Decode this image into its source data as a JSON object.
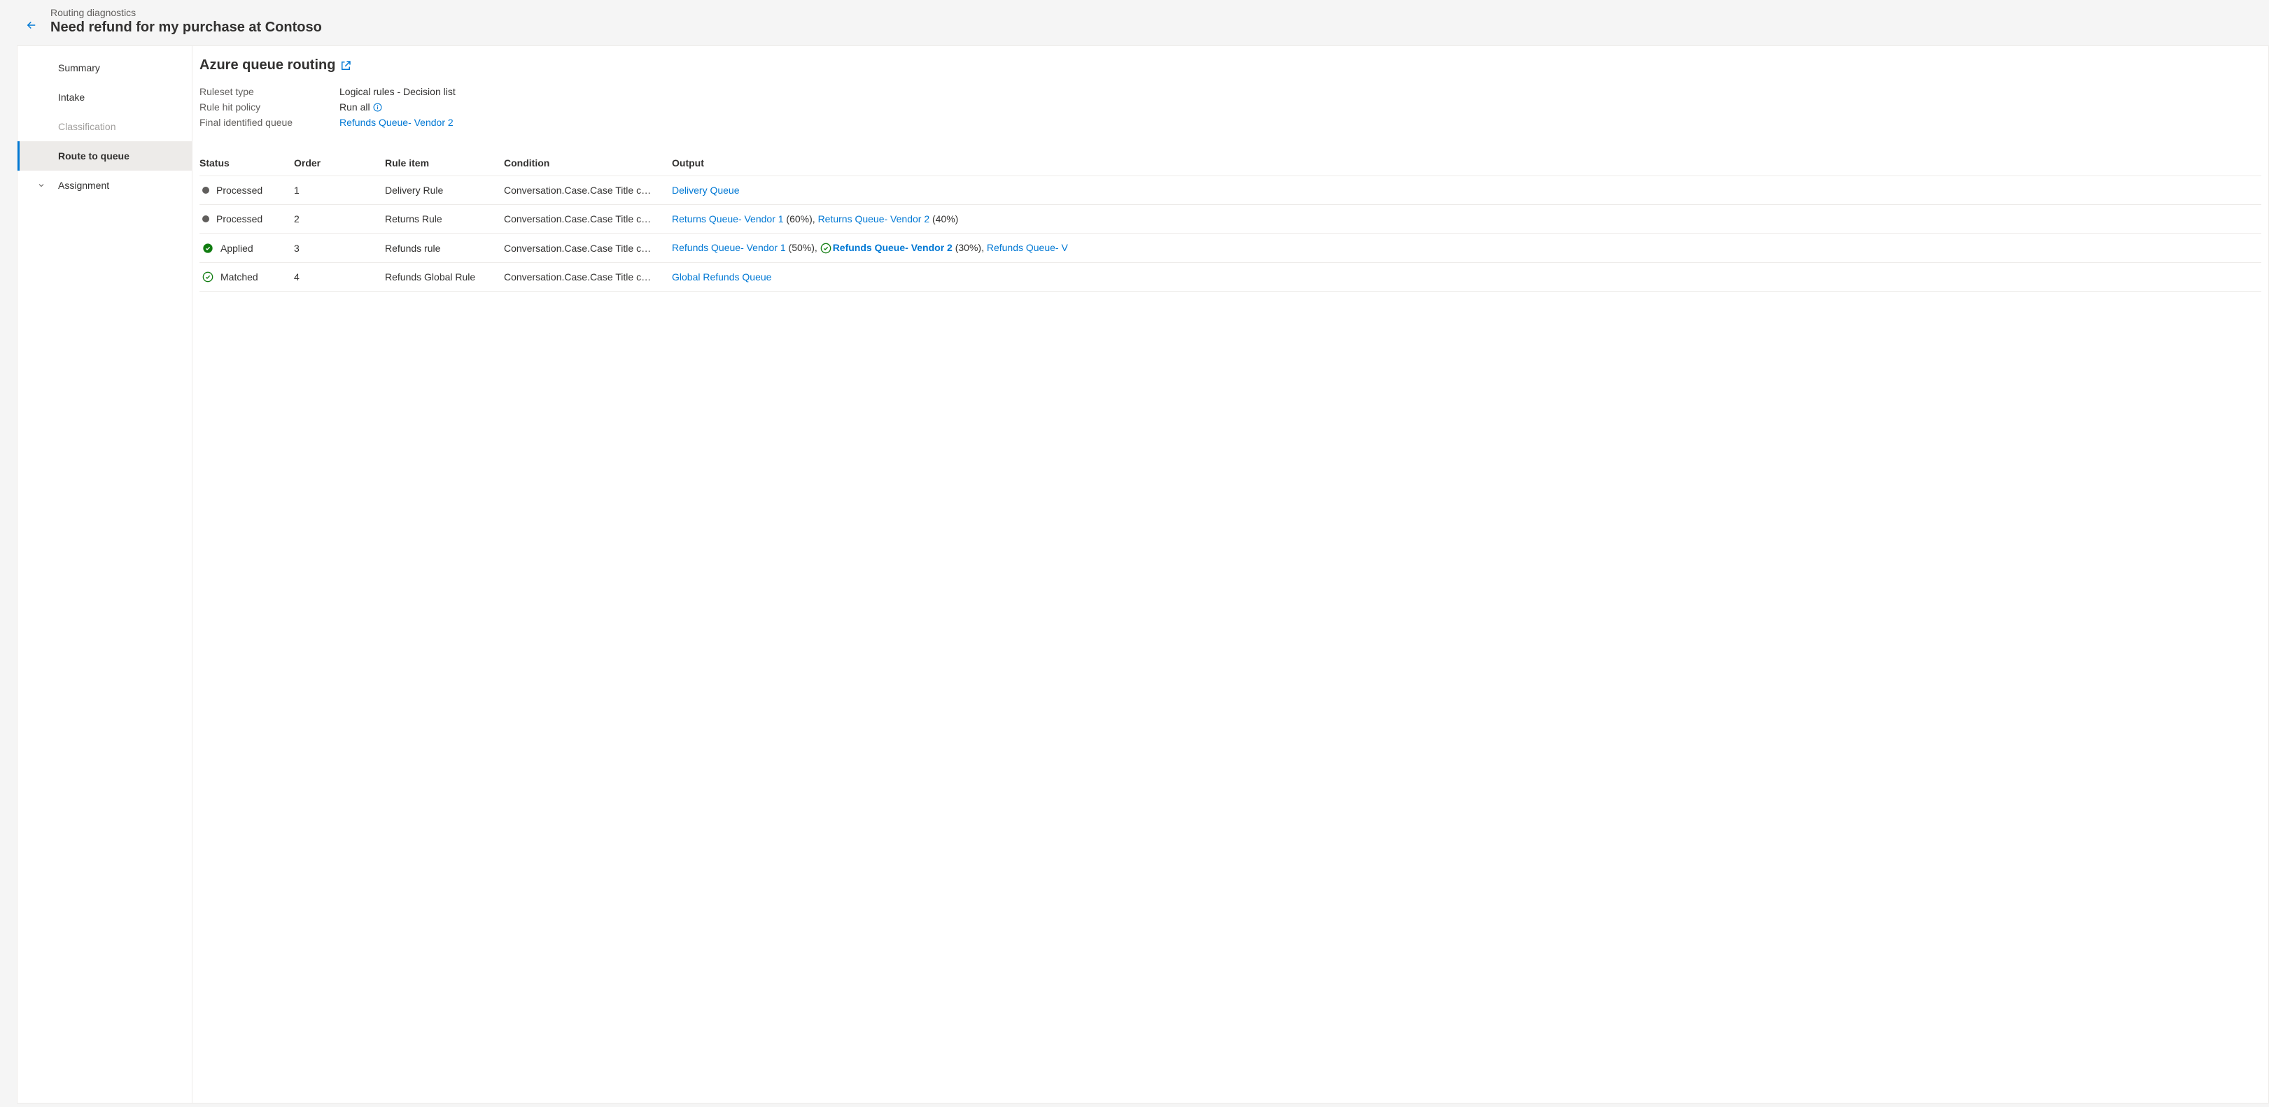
{
  "header": {
    "breadcrumb": "Routing diagnostics",
    "title": "Need refund for my purchase at Contoso"
  },
  "sidebar": {
    "items": [
      {
        "label": "Summary"
      },
      {
        "label": "Intake"
      },
      {
        "label": "Classification"
      },
      {
        "label": "Route to queue"
      },
      {
        "label": "Assignment"
      }
    ]
  },
  "main": {
    "section_title": "Azure queue routing",
    "kv": {
      "ruleset_type_label": "Ruleset type",
      "ruleset_type_value": "Logical rules - Decision list",
      "rule_hit_label": "Rule hit policy",
      "rule_hit_value": "Run all",
      "final_queue_label": "Final identified queue",
      "final_queue_value": "Refunds Queue- Vendor 2"
    },
    "columns": {
      "status": "Status",
      "order": "Order",
      "rule_item": "Rule item",
      "condition": "Condition",
      "output": "Output"
    },
    "rows": [
      {
        "status": "Processed",
        "status_kind": "processed",
        "order": "1",
        "rule_item": "Delivery Rule",
        "condition": "Conversation.Case.Case Title c…",
        "outputs": [
          {
            "text": "Delivery Queue",
            "pct": ""
          }
        ]
      },
      {
        "status": "Processed",
        "status_kind": "processed",
        "order": "2",
        "rule_item": "Returns Rule",
        "condition": "Conversation.Case.Case Title c…",
        "outputs": [
          {
            "text": "Returns Queue- Vendor 1",
            "pct": " (60%), "
          },
          {
            "text": "Returns Queue- Vendor 2",
            "pct": " (40%)"
          }
        ]
      },
      {
        "status": "Applied",
        "status_kind": "applied",
        "order": "3",
        "rule_item": "Refunds rule",
        "condition": "Conversation.Case.Case Title c…",
        "outputs": [
          {
            "text": "Refunds Queue- Vendor 1",
            "pct": " (50%), ",
            "bold": false
          },
          {
            "text": "Refunds Queue- Vendor 2",
            "pct": " (30%), ",
            "bold": true,
            "checked": true
          },
          {
            "text": "Refunds Queue- V",
            "pct": "",
            "bold": false
          }
        ]
      },
      {
        "status": "Matched",
        "status_kind": "matched",
        "order": "4",
        "rule_item": "Refunds Global Rule",
        "condition": "Conversation.Case.Case Title c…",
        "outputs": [
          {
            "text": "Global Refunds Queue",
            "pct": ""
          }
        ]
      }
    ]
  }
}
